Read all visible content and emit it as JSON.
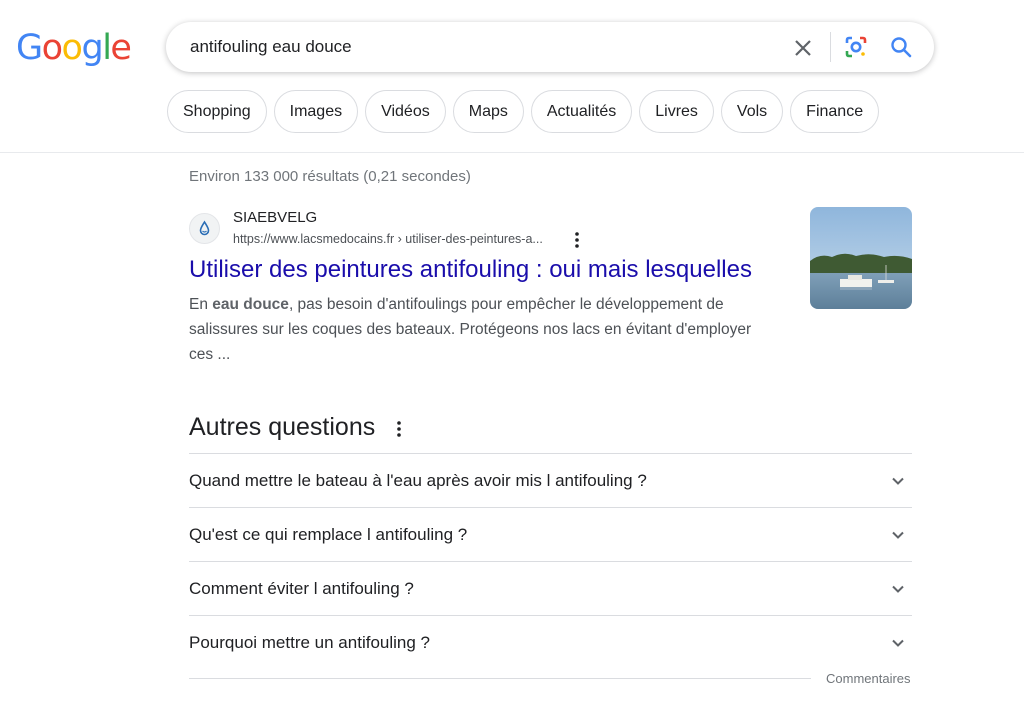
{
  "logo": {
    "letters": [
      "G",
      "o",
      "o",
      "g",
      "l",
      "e"
    ],
    "colors": [
      "#4285F4",
      "#EA4335",
      "#FBBC05",
      "#4285F4",
      "#34A853",
      "#EA4335"
    ]
  },
  "search": {
    "query": "antifouling eau douce"
  },
  "chips": [
    "Shopping",
    "Images",
    "Vidéos",
    "Maps",
    "Actualités",
    "Livres",
    "Vols",
    "Finance"
  ],
  "stats": "Environ 133 000 résultats (0,21 secondes)",
  "result": {
    "site_name": "SIAEBVELG",
    "url": "https://www.lacsmedocains.fr › utiliser-des-peintures-a...",
    "title": "Utiliser des peintures antifouling : oui mais lesquelles",
    "snippet_prefix": "En ",
    "snippet_bold": "eau douce",
    "snippet_rest": ", pas besoin d'antifoulings pour empêcher le développement de salissures sur les coques des bateaux. Protégeons nos lacs en évitant d'employer ces ..."
  },
  "paa": {
    "title": "Autres questions",
    "questions": [
      "Quand mettre le bateau à l'eau après avoir mis l antifouling ?",
      "Qu'est ce qui remplace l antifouling ?",
      "Comment éviter l antifouling ?",
      "Pourquoi mettre un antifouling ?"
    ]
  },
  "feedback": "Commentaires",
  "colors": {
    "link": "#1a0dab",
    "text": "#202124",
    "muted": "#70757a",
    "border": "#dadce0"
  }
}
